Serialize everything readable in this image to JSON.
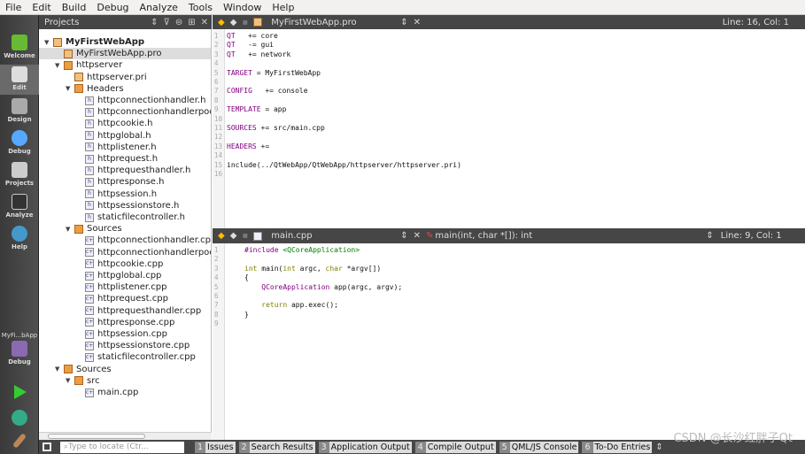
{
  "menu": [
    "File",
    "Edit",
    "Build",
    "Debug",
    "Analyze",
    "Tools",
    "Window",
    "Help"
  ],
  "modes": [
    {
      "label": "Welcome"
    },
    {
      "label": "Edit"
    },
    {
      "label": "Design"
    },
    {
      "label": "Debug"
    },
    {
      "label": "Projects"
    },
    {
      "label": "Analyze"
    },
    {
      "label": "Help"
    }
  ],
  "kit": {
    "project": "MyFi...bApp",
    "label": "Debug"
  },
  "projects": {
    "title": "Projects",
    "tree": [
      {
        "t": "MyFirstWebApp",
        "d": 0,
        "k": "pro",
        "a": "▼",
        "b": true
      },
      {
        "t": "MyFirstWebApp.pro",
        "d": 1,
        "k": "pro",
        "a": "",
        "sel": true
      },
      {
        "t": "httpserver",
        "d": 1,
        "k": "folder",
        "a": "▼"
      },
      {
        "t": "httpserver.pri",
        "d": 2,
        "k": "pro",
        "a": ""
      },
      {
        "t": "Headers",
        "d": 2,
        "k": "folder",
        "a": "▼"
      },
      {
        "t": "httpconnectionhandler.h",
        "d": 3,
        "k": "h",
        "a": ""
      },
      {
        "t": "httpconnectionhandlerpool.h",
        "d": 3,
        "k": "h",
        "a": ""
      },
      {
        "t": "httpcookie.h",
        "d": 3,
        "k": "h",
        "a": ""
      },
      {
        "t": "httpglobal.h",
        "d": 3,
        "k": "h",
        "a": ""
      },
      {
        "t": "httplistener.h",
        "d": 3,
        "k": "h",
        "a": ""
      },
      {
        "t": "httprequest.h",
        "d": 3,
        "k": "h",
        "a": ""
      },
      {
        "t": "httprequesthandler.h",
        "d": 3,
        "k": "h",
        "a": ""
      },
      {
        "t": "httpresponse.h",
        "d": 3,
        "k": "h",
        "a": ""
      },
      {
        "t": "httpsession.h",
        "d": 3,
        "k": "h",
        "a": ""
      },
      {
        "t": "httpsessionstore.h",
        "d": 3,
        "k": "h",
        "a": ""
      },
      {
        "t": "staticfilecontroller.h",
        "d": 3,
        "k": "h",
        "a": ""
      },
      {
        "t": "Sources",
        "d": 2,
        "k": "folder",
        "a": "▼"
      },
      {
        "t": "httpconnectionhandler.cpp",
        "d": 3,
        "k": "c",
        "a": ""
      },
      {
        "t": "httpconnectionhandlerpool.cpp",
        "d": 3,
        "k": "c",
        "a": ""
      },
      {
        "t": "httpcookie.cpp",
        "d": 3,
        "k": "c",
        "a": ""
      },
      {
        "t": "httpglobal.cpp",
        "d": 3,
        "k": "c",
        "a": ""
      },
      {
        "t": "httplistener.cpp",
        "d": 3,
        "k": "c",
        "a": ""
      },
      {
        "t": "httprequest.cpp",
        "d": 3,
        "k": "c",
        "a": ""
      },
      {
        "t": "httprequesthandler.cpp",
        "d": 3,
        "k": "c",
        "a": ""
      },
      {
        "t": "httpresponse.cpp",
        "d": 3,
        "k": "c",
        "a": ""
      },
      {
        "t": "httpsession.cpp",
        "d": 3,
        "k": "c",
        "a": ""
      },
      {
        "t": "httpsessionstore.cpp",
        "d": 3,
        "k": "c",
        "a": ""
      },
      {
        "t": "staticfilecontroller.cpp",
        "d": 3,
        "k": "c",
        "a": ""
      },
      {
        "t": "Sources",
        "d": 1,
        "k": "folder",
        "a": "▼"
      },
      {
        "t": "src",
        "d": 2,
        "k": "folder",
        "a": "▼"
      },
      {
        "t": "main.cpp",
        "d": 3,
        "k": "c",
        "a": ""
      }
    ]
  },
  "editor1": {
    "file": "MyFirstWebApp.pro",
    "pos": "Line: 16, Col: 1",
    "lines": [
      [
        [
          "mac",
          "QT"
        ],
        [
          "",
          "   += core"
        ]
      ],
      [
        [
          "mac",
          "QT"
        ],
        [
          "",
          "   -= gui"
        ]
      ],
      [
        [
          "mac",
          "QT"
        ],
        [
          "",
          "   += network"
        ]
      ],
      [],
      [
        [
          "mac",
          "TARGET"
        ],
        [
          "",
          " = MyFirstWebApp"
        ]
      ],
      [],
      [
        [
          "mac",
          "CONFIG"
        ],
        [
          "",
          "   += console"
        ]
      ],
      [],
      [
        [
          "mac",
          "TEMPLATE"
        ],
        [
          "",
          " = app"
        ]
      ],
      [],
      [
        [
          "mac",
          "SOURCES"
        ],
        [
          "",
          " += src/main.cpp"
        ]
      ],
      [],
      [
        [
          "mac",
          "HEADERS"
        ],
        [
          "",
          " +="
        ]
      ],
      [],
      [
        [
          "",
          "include(../QtWebApp/QtWebApp/httpserver/httpserver.pri)"
        ]
      ],
      []
    ]
  },
  "editor2": {
    "file": "main.cpp",
    "symbol": "main(int, char *[]): int",
    "pos": "Line: 9, Col: 1",
    "lines": [
      [
        [
          "mac",
          "#include "
        ],
        [
          "str",
          "<QCoreApplication>"
        ]
      ],
      [],
      [
        [
          "kw",
          "int"
        ],
        [
          "",
          " main("
        ],
        [
          "kw",
          "int"
        ],
        [
          "",
          " argc, "
        ],
        [
          "kw",
          "char"
        ],
        [
          "",
          " *argv[])"
        ]
      ],
      [
        [
          "",
          "{"
        ]
      ],
      [
        [
          "",
          "    "
        ],
        [
          "mac",
          "QCoreApplication"
        ],
        [
          "",
          " app(argc, argv);"
        ]
      ],
      [],
      [
        [
          "",
          "    "
        ],
        [
          "kw",
          "return"
        ],
        [
          "",
          " app.exec();"
        ]
      ],
      [
        [
          "",
          "}"
        ]
      ],
      []
    ]
  },
  "bottom": {
    "locate_placeholder": "Type to locate (Ctr...",
    "tabs": [
      {
        "n": "1",
        "l": "Issues"
      },
      {
        "n": "2",
        "l": "Search Results"
      },
      {
        "n": "3",
        "l": "Application Output"
      },
      {
        "n": "4",
        "l": "Compile Output"
      },
      {
        "n": "5",
        "l": "QML/JS Console"
      },
      {
        "n": "6",
        "l": "To-Do Entries"
      }
    ]
  },
  "watermark": "CSDN @长沙红胖子Qt"
}
